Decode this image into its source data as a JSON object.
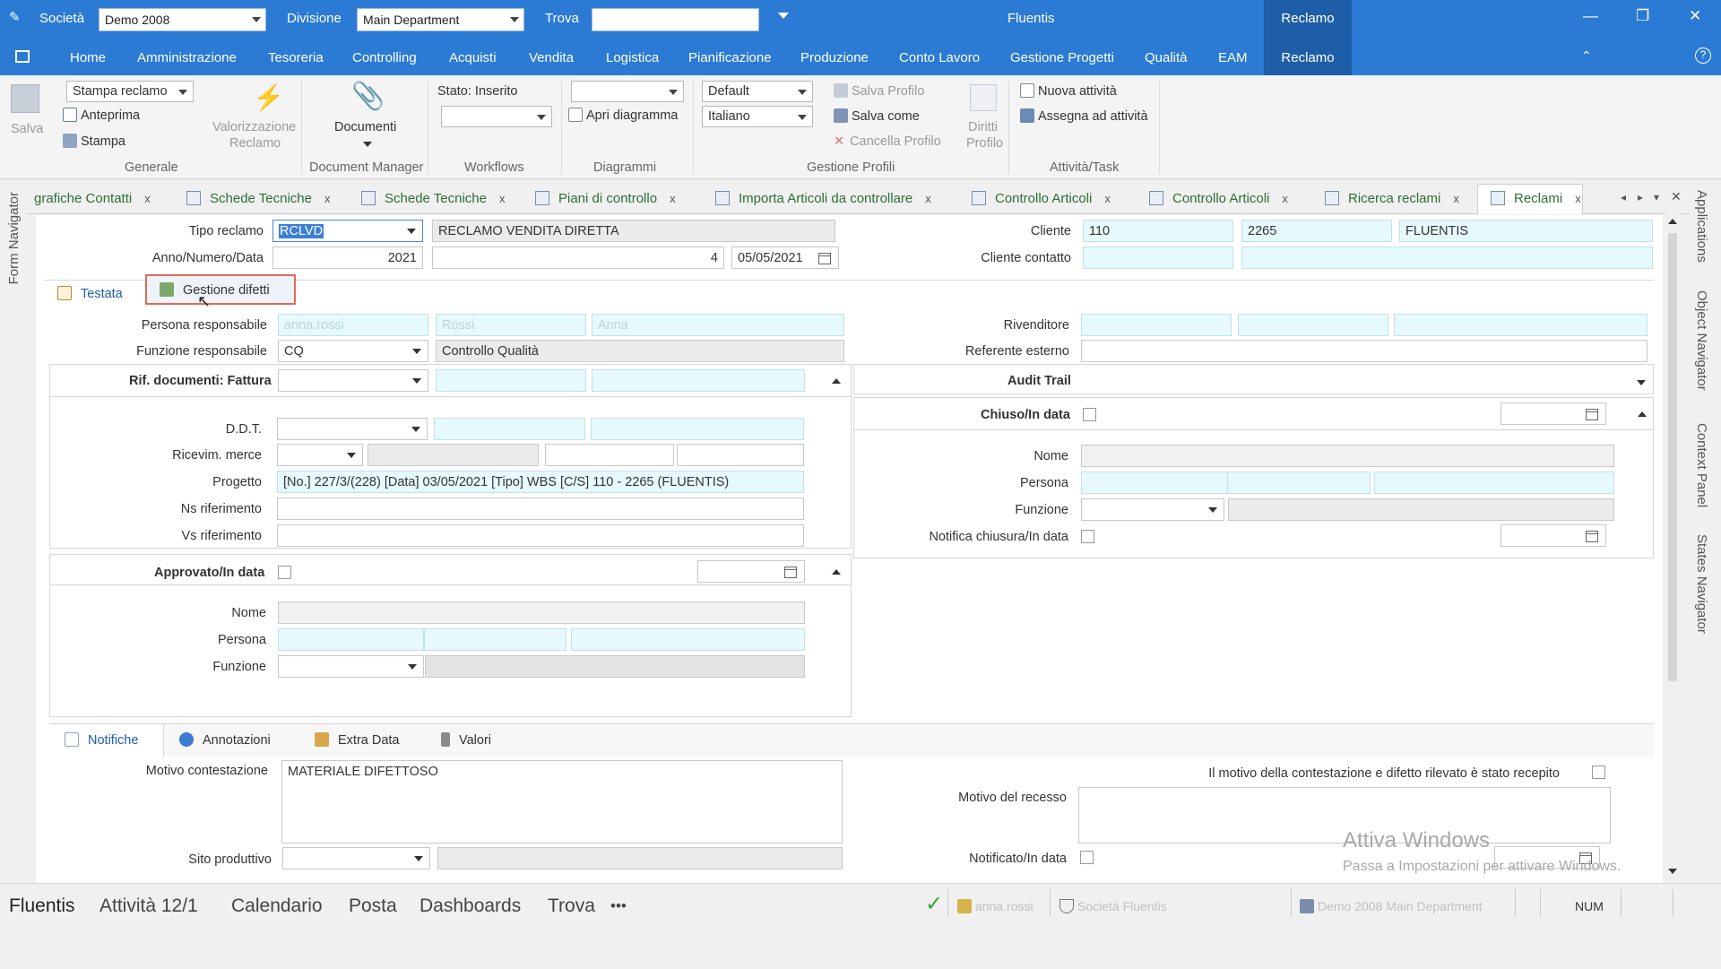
{
  "titlebar": {
    "societa_label": "Società",
    "societa_value": "Demo 2008",
    "divisione_label": "Divisione",
    "divisione_value": "Main Department",
    "trova_label": "Trova",
    "trova_value": "",
    "app_title": "Fluentis",
    "context_tab": "Reclamo",
    "minimize": "—",
    "restore": "❐",
    "close": "✕"
  },
  "menu": {
    "items": [
      "Home",
      "Amministrazione",
      "Tesoreria",
      "Controlling",
      "Acquisti",
      "Vendita",
      "Logistica",
      "Pianificazione",
      "Produzione",
      "Conto Lavoro",
      "Gestione Progetti",
      "Qualità",
      "EAM",
      "Reclamo"
    ],
    "active": "Reclamo"
  },
  "ribbon": {
    "salva": "Salva",
    "stampa_reclamo": "Stampa reclamo",
    "anteprima": "Anteprima",
    "stampa": "Stampa",
    "valorizzazione_1": "Valorizzazione",
    "valorizzazione_2": "Reclamo",
    "documenti": "Documenti",
    "stato": "Stato: Inserito",
    "apri_diagramma": "Apri diagramma",
    "default": "Default",
    "italiano": "Italiano",
    "salva_profilo": "Salva Profilo",
    "salva_come": "Salva come",
    "cancella_profilo": "Cancella Profilo",
    "diritti_1": "Diritti",
    "diritti_2": "Profilo",
    "nuova_attivita": "Nuova attività",
    "assegna_attivita": "Assegna ad attività",
    "groups": {
      "generale": "Generale",
      "document_manager": "Document Manager",
      "workflows": "Workflows",
      "diagrammi": "Diagrammi",
      "gestione_profili": "Gestione Profili",
      "attivita_task": "Attività/Task"
    }
  },
  "doc_tabs": [
    "grafiche Contatti",
    "Schede Tecniche",
    "Schede Tecniche",
    "Piani di controllo",
    "Importa Articoli da controllare",
    "Controllo Articoli",
    "Controllo Articoli",
    "Ricerca reclami",
    "Reclami"
  ],
  "doc_tab_close": "x",
  "side_left": "Form Navigator",
  "side_right": [
    "Applications",
    "Object Navigator",
    "Context Panel",
    "States Navigator"
  ],
  "form": {
    "tipo_reclamo_label": "Tipo reclamo",
    "tipo_reclamo_code": "RCLVD",
    "tipo_reclamo_desc": "RECLAMO VENDITA DIRETTA",
    "anno_label": "Anno/Numero/Data",
    "anno": "2021",
    "numero": "4",
    "data": "05/05/2021",
    "cliente_label": "Cliente",
    "cliente_code": "110",
    "cliente_num": "2265",
    "cliente_name": "FLUENTIS",
    "cliente_contatto_label": "Cliente contatto",
    "tab_testata": "Testata",
    "tab_gestione": "Gestione difetti",
    "persona_resp_label": "Persona responsabile",
    "persona_resp_1": "anna.rossi",
    "persona_resp_2": "Rossi",
    "persona_resp_3": "Anna",
    "funzione_resp_label": "Funzione responsabile",
    "funzione_resp_code": "CQ",
    "funzione_resp_desc": "Controllo Qualità",
    "rivenditore_label": "Rivenditore",
    "referente_label": "Referente esterno",
    "rif_doc_label": "Rif. documenti: Fattura",
    "audit_trail": "Audit Trail",
    "ddt_label": "D.D.T.",
    "ricevim_label": "Ricevim. merce",
    "progetto_label": "Progetto",
    "progetto_value": "[No.] 227/3/(228) [Data] 03/05/2021 [Tipo] WBS [C/S] 110 - 2265 (FLUENTIS)",
    "ns_rif_label": "Ns riferimento",
    "vs_rif_label": "Vs riferimento",
    "chiuso_label": "Chiuso/In data",
    "nome_label": "Nome",
    "persona_label": "Persona",
    "funzione_label": "Funzione",
    "notifica_chiusura_label": "Notifica chiusura/In data",
    "approvato_label": "Approvato/In data",
    "subtabs": [
      "Notifiche",
      "Annotazioni",
      "Extra Data",
      "Valori"
    ],
    "motivo_contestazione_label": "Motivo contestazione",
    "motivo_contestazione_value": "MATERIALE DIFETTOSO",
    "recepito_label": "Il motivo della contestazione e difetto rilevato è stato recepito",
    "motivo_recesso_label": "Motivo del recesso",
    "sito_produttivo_label": "Sito produttivo",
    "notificato_label": "Notificato/In data"
  },
  "watermark": {
    "line1": "Attiva Windows",
    "line2": "Passa a Impostazioni per attivare Windows."
  },
  "statusbar": {
    "items": [
      "Fluentis",
      "Attività 12/1",
      "Calendario",
      "Posta",
      "Dashboards",
      "Trova"
    ],
    "more": "•••",
    "user": "anna.rossi",
    "company": "Società Fluentis",
    "division": "Demo 2008 Main Department",
    "num": "NUM"
  },
  "colors": {
    "accent": "#2b7bd4",
    "accent_dark": "#1e5ea8",
    "field_cyan": "#e6f9fd",
    "tab_text": "#2d6f34",
    "ok_check": "#3aa53a"
  }
}
